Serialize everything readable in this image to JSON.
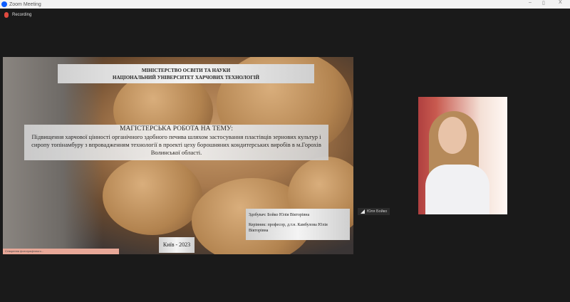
{
  "window": {
    "title": "Zoom Meeting",
    "minimize": "–",
    "restore": "▯",
    "close": "X"
  },
  "recording": {
    "label": "Recording"
  },
  "slide": {
    "header_line1": "МІНІСТЕРСТВО ОСВІТИ ТА НАУКИ",
    "header_line2": "НАЦІОНАЛЬНИЙ УНІВЕРСИТЕТ ХАРЧОВИХ ТЕХНОЛОГІЙ",
    "topic_heading": "МАГІСТЕРСЬКА РОБОТА НА ТЕМУ:",
    "topic_text": "Підвищення харчової цінності органічного здобного печива шляхом застосування пластівців зернових культур і сиропу топінамбуру з впровадженням технології в проекті цеху борошняних кондитерських виробів в м.Горохів Волинської області.",
    "student": "Здобувач: Бойко Юлія Вікторівна",
    "supervisor": "Керівник: професор, д.т.н. Камбулова Юлія Вікторівна",
    "city_year": "Київ - 2023"
  },
  "share_bar": {
    "label": "Створення фотографічного..."
  },
  "participant": {
    "name": "Юля Бойко"
  }
}
